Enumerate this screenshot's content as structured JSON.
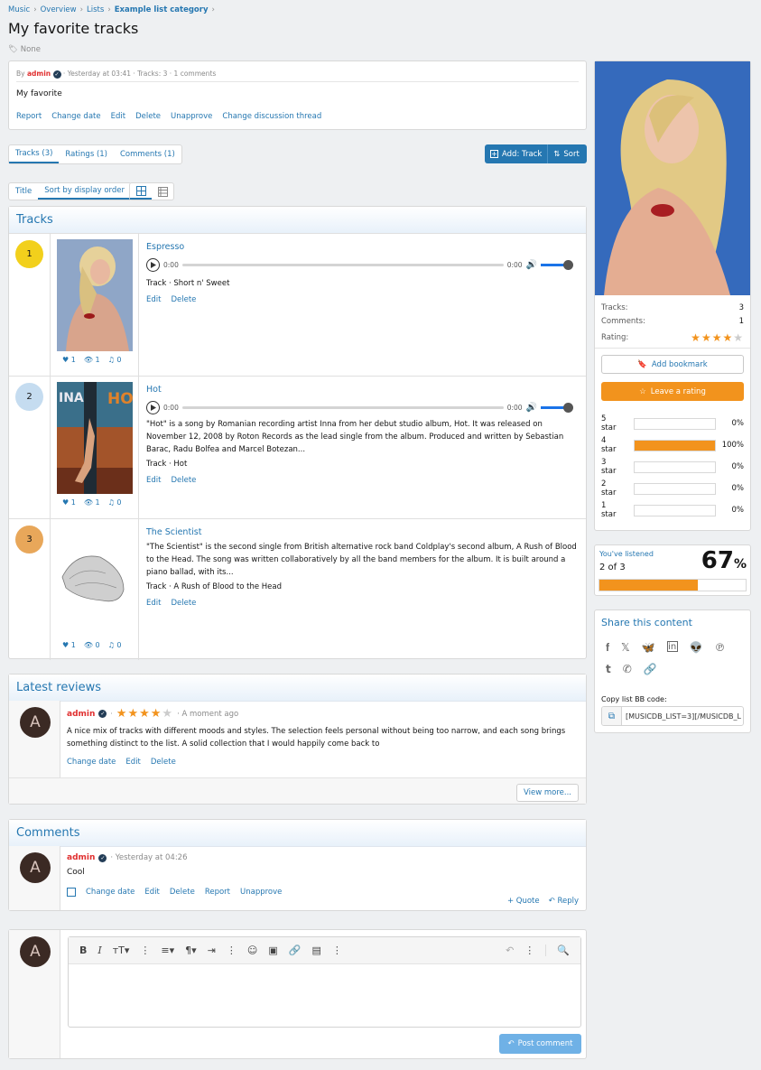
{
  "breadcrumb": [
    "Music",
    "Overview",
    "Lists",
    "Example list category"
  ],
  "page": {
    "title": "My favorite tracks",
    "tags": "None"
  },
  "list": {
    "by_label": "By",
    "author": "admin",
    "meta": "· Yesterday at 03:41 · Tracks: 3 · 1 comments",
    "description": "My favorite",
    "actions": [
      "Report",
      "Change date",
      "Edit",
      "Delete",
      "Unapprove",
      "Change discussion thread"
    ]
  },
  "tabs": [
    "Tracks (3)",
    "Ratings (1)",
    "Comments (1)"
  ],
  "toolbar": {
    "add_track": "Add: Track",
    "sort": "Sort"
  },
  "sort_tabs": [
    "Title",
    "Sort by display order"
  ],
  "tracks_block": {
    "title": "Tracks",
    "items": [
      {
        "rank": "1",
        "rank_color": "#f2d01c",
        "title": "Espresso",
        "time_start": "0:00",
        "time_end": "0:00",
        "description": "",
        "track_line": "Track · Short n' Sweet",
        "actions": [
          "Edit",
          "Delete"
        ],
        "likes": "1",
        "views": "1",
        "plays": "0"
      },
      {
        "rank": "2",
        "rank_color": "#c5dcf0",
        "title": "Hot",
        "time_start": "0:00",
        "time_end": "0:00",
        "description": "\"Hot\" is a song by Romanian recording artist Inna from her debut studio album, Hot. It was released on November 12, 2008 by Roton Records as the lead single from the album. Produced and written by Sebastian Barac, Radu Bolfea and Marcel Botezan...",
        "track_line": "Track · Hot",
        "actions": [
          "Edit",
          "Delete"
        ],
        "likes": "1",
        "views": "1",
        "plays": "0"
      },
      {
        "rank": "3",
        "rank_color": "#e8a75a",
        "title": "The Scientist",
        "description": "\"The Scientist\" is the second single from British alternative rock band Coldplay's second album, A Rush of Blood to the Head. The song was written collaboratively by all the band members for the album. It is built around a piano ballad, with its...",
        "track_line": "Track · A Rush of Blood to the Head",
        "actions": [
          "Edit",
          "Delete"
        ],
        "likes": "1",
        "views": "0",
        "plays": "0"
      }
    ],
    "hot_cover_text": "INA HO"
  },
  "reviews": {
    "title": "Latest reviews",
    "author": "admin",
    "avatar_letter": "A",
    "rating": 4,
    "time": "· A moment ago",
    "text": "A nice mix of tracks with different moods and styles. The selection feels personal without being too narrow, and each song brings something distinct to the list. A solid collection that I would happily come back to",
    "actions": [
      "Change date",
      "Edit",
      "Delete"
    ],
    "view_more": "View more..."
  },
  "comments": {
    "title": "Comments",
    "author": "admin",
    "avatar_letter": "A",
    "time": "· Yesterday at 04:26",
    "text": "Cool",
    "actions": [
      "Change date",
      "Edit",
      "Delete",
      "Report",
      "Unapprove"
    ],
    "quote": "Quote",
    "reply": "Reply"
  },
  "editor": {
    "avatar_letter": "A",
    "post_label": "Post comment"
  },
  "sidebar": {
    "stats": [
      {
        "label": "Tracks:",
        "value": "3"
      },
      {
        "label": "Comments:",
        "value": "1"
      }
    ],
    "rating_label": "Rating:",
    "rating": 4,
    "add_bookmark": "Add bookmark",
    "leave_rating": "Leave a rating",
    "breakdown": [
      {
        "label": "5 star",
        "pct": "0%",
        "fill": 0
      },
      {
        "label": "4 star",
        "pct": "100%",
        "fill": 100
      },
      {
        "label": "3 star",
        "pct": "0%",
        "fill": 0
      },
      {
        "label": "2 star",
        "pct": "0%",
        "fill": 0
      },
      {
        "label": "1 star",
        "pct": "0%",
        "fill": 0
      }
    ],
    "listened": {
      "label": "You've listened",
      "count": "2 of 3",
      "percent": "67",
      "percent_sign": "%",
      "fill": 67
    },
    "share": {
      "title": "Share this content",
      "icons": [
        "facebook-icon",
        "x-icon",
        "bluesky-icon",
        "linkedin-icon",
        "reddit-icon",
        "pinterest-icon",
        "tumblr-icon",
        "whatsapp-icon",
        "link-icon"
      ],
      "bb_label": "Copy list BB code:",
      "bb_value": "[MUSICDB_LIST=3][/MUSICDB_L"
    }
  },
  "colors": {
    "accent": "#2577b1",
    "star": "#f2931d",
    "username": "#e02f2f"
  }
}
